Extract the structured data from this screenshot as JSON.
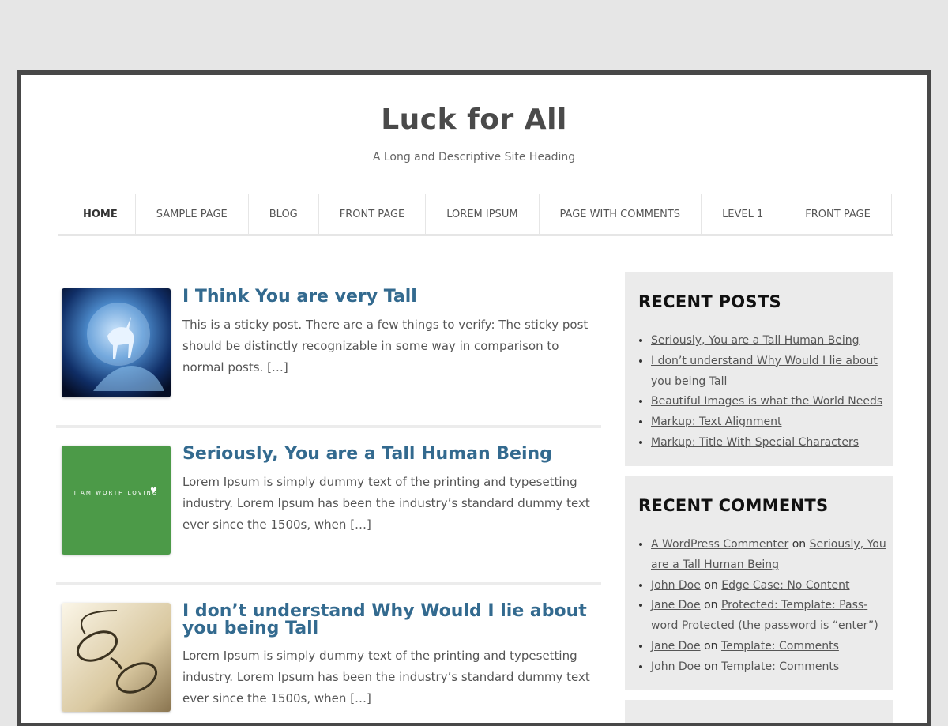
{
  "site": {
    "title": "Luck for All",
    "description": "A Long and Descriptive Site Heading"
  },
  "nav": [
    {
      "label": "HOME",
      "active": true
    },
    {
      "label": "SAMPLE PAGE"
    },
    {
      "label": "BLOG"
    },
    {
      "label": "FRONT PAGE"
    },
    {
      "label": "LOREM IPSUM"
    },
    {
      "label": "PAGE WITH COMMENTS"
    },
    {
      "label": "LEVEL 1"
    },
    {
      "label": "FRONT PAGE"
    }
  ],
  "posts": [
    {
      "title": "I Think You are very Tall",
      "excerpt": "This is a sticky post. There are a few things to verify: The sticky post should be distinctly recognizable in some way in comparison to normal posts. […]",
      "thumbnail": "unicorn-image"
    },
    {
      "title": "Seriously, You are a Tall Human Being",
      "excerpt": "Lorem Ipsum is simply dummy text of the printing and typesetting in­dustry. Lorem Ipsum has been the industry’s standard dummy text ever since the 1500s, when […]",
      "thumbnail": "green-banner-image",
      "thumbnail_text": "I AM WORTH LOVING"
    },
    {
      "title": "I don’t understand Why Would I lie about you being Tall",
      "excerpt": "Lorem Ipsum is simply dummy text of the printing and typesetting in­dustry. Lorem Ipsum has been the industry’s standard dummy text ever since the 1500s, when […]",
      "thumbnail": "glasses-image"
    }
  ],
  "widgets": {
    "recent_posts": {
      "title": "RECENT POSTS",
      "items": [
        "Seriously, You are a Tall Human Being",
        "I don’t understand Why Would I lie about you being Tall",
        "Beautiful Images is what the World Needs",
        "Markup: Text Alignment",
        "Markup: Title With Special Characters"
      ]
    },
    "recent_comments": {
      "title": "RECENT COMMENTS",
      "items": [
        {
          "author": "A WordPress Commenter",
          "on": "on",
          "post": "Seriously, You are a Tall Human Being"
        },
        {
          "author": "John Doe",
          "on": "on",
          "post": "Edge Case: No Content"
        },
        {
          "author": "Jane Doe",
          "on": "on",
          "post": "Protected: Template: Pass­word Protected (the password is “enter”)"
        },
        {
          "author": "Jane Doe",
          "on": "on",
          "post": "Template: Comments"
        },
        {
          "author": "John Doe",
          "on": "on",
          "post": "Template: Comments"
        }
      ]
    }
  },
  "colors": {
    "background": "#e6e6e6",
    "frame": "#484848",
    "post_title": "#336a8f",
    "widget_bg": "#ebebeb",
    "thumb_green": "#4c9a48"
  }
}
